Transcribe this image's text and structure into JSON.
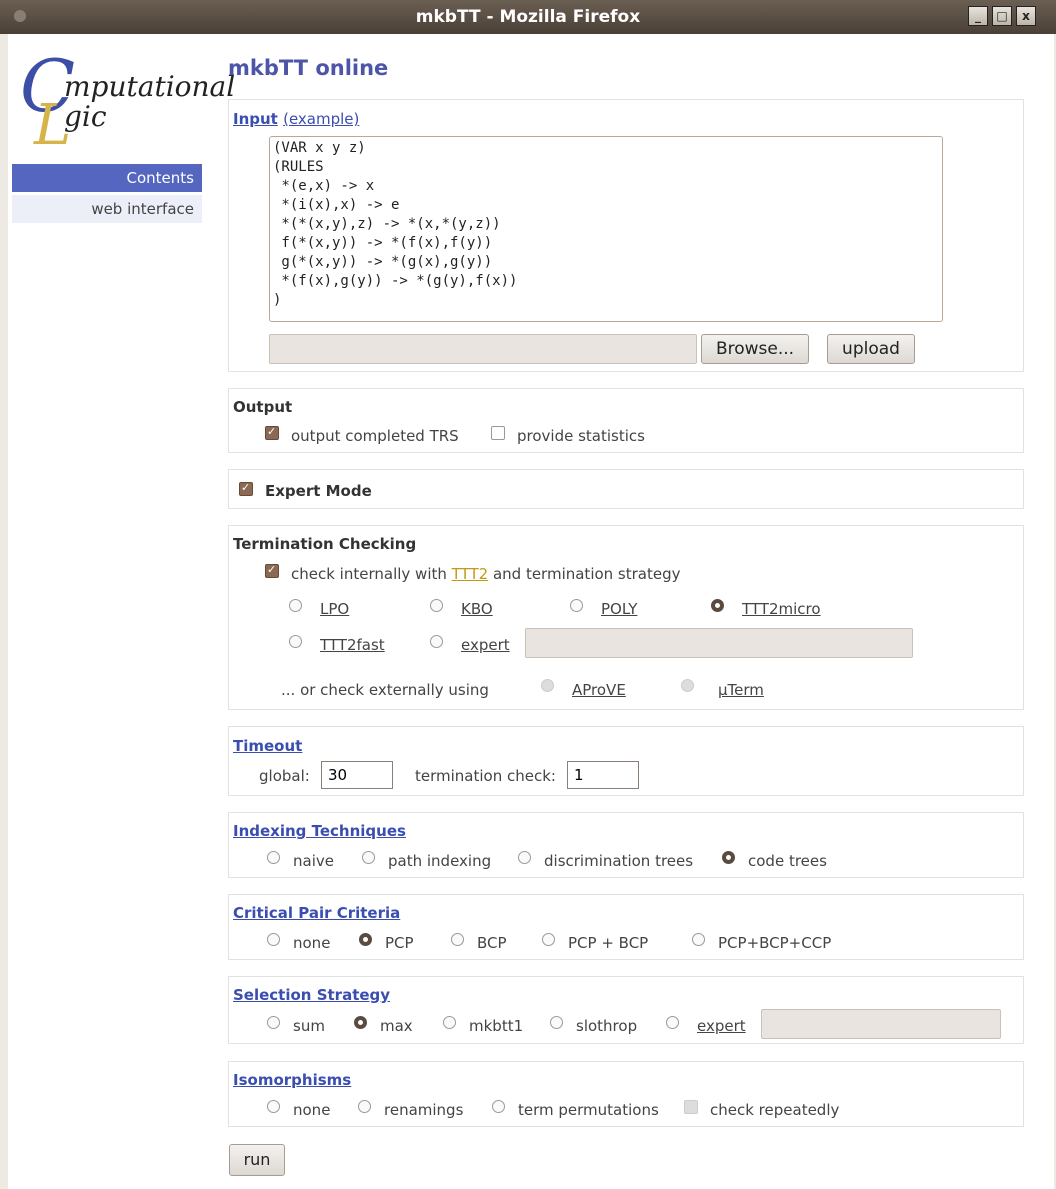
{
  "window": {
    "title": "mkbTT - Mozilla Firefox"
  },
  "nav": {
    "items": [
      "Contents",
      "web interface"
    ]
  },
  "page": {
    "title": "mkbTT online"
  },
  "input": {
    "heading": "Input",
    "example_link": "(example)",
    "code": "(VAR x y z)\n(RULES\n *(e,x) -> x\n *(i(x),x) -> e\n *(*(x,y),z) -> *(x,*(y,z))\n f(*(x,y)) -> *(f(x),f(y))\n g(*(x,y)) -> *(g(x),g(y))\n *(f(x),g(y)) -> *(g(y),f(x))\n)",
    "browse_label": "Browse...",
    "upload_label": "upload"
  },
  "output": {
    "heading": "Output",
    "options": [
      {
        "label": "output completed TRS",
        "checked": true
      },
      {
        "label": "provide statistics",
        "checked": false
      }
    ]
  },
  "expert_mode": {
    "label": "Expert Mode",
    "checked": true
  },
  "termination": {
    "heading": "Termination Checking",
    "internal_prefix": "check internally with",
    "internal_tool": "TTT2",
    "internal_suffix": "and termination strategy",
    "strategies": [
      {
        "label": "LPO",
        "selected": false
      },
      {
        "label": "KBO",
        "selected": false
      },
      {
        "label": "POLY",
        "selected": false
      },
      {
        "label": "TTT2micro",
        "selected": true
      },
      {
        "label": "TTT2fast",
        "selected": false
      },
      {
        "label": "expert",
        "selected": false
      }
    ],
    "external_label": "... or check externally using",
    "external_tools": [
      "AProVE",
      "µTerm"
    ]
  },
  "timeout": {
    "heading": "Timeout",
    "global_label": "global:",
    "global_value": "30",
    "termination_label": "termination check:",
    "termination_value": "1"
  },
  "indexing": {
    "heading": "Indexing Techniques",
    "options": [
      {
        "label": "naive",
        "selected": false
      },
      {
        "label": "path indexing",
        "selected": false
      },
      {
        "label": "discrimination trees",
        "selected": false
      },
      {
        "label": "code trees",
        "selected": true
      }
    ]
  },
  "critical_pair": {
    "heading": "Critical Pair Criteria",
    "options": [
      {
        "label": "none",
        "selected": false
      },
      {
        "label": "PCP",
        "selected": true
      },
      {
        "label": "BCP",
        "selected": false
      },
      {
        "label": "PCP + BCP",
        "selected": false
      },
      {
        "label": "PCP+BCP+CCP",
        "selected": false
      }
    ]
  },
  "selection": {
    "heading": "Selection Strategy",
    "options": [
      {
        "label": "sum",
        "selected": false
      },
      {
        "label": "max",
        "selected": true
      },
      {
        "label": "mkbtt1",
        "selected": false
      },
      {
        "label": "slothrop",
        "selected": false
      },
      {
        "label": "expert",
        "selected": false
      }
    ]
  },
  "isomorphisms": {
    "heading": "Isomorphisms",
    "options": [
      {
        "label": "none",
        "selected": false
      },
      {
        "label": "renamings",
        "selected": false
      },
      {
        "label": "term permutations",
        "selected": false
      }
    ],
    "check_repeatedly": "check repeatedly"
  },
  "run_label": "run"
}
